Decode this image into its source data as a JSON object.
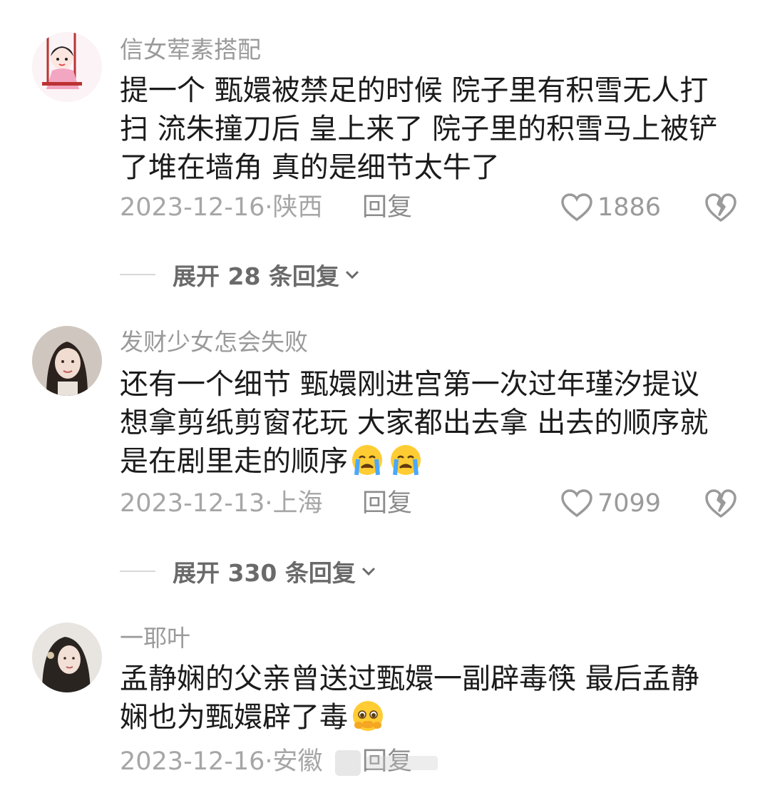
{
  "comments": [
    {
      "username": "信女荤素搭配",
      "lines": [
        "提一个 甄嬛被禁足的时候 院子里有积雪无人打",
        "扫 流朱撞刀后 皇上来了 院子里的积雪马上被铲",
        "了堆在墙角 真的是细节太牛了"
      ],
      "date": "2023-12-16",
      "location": "陕西",
      "date_sep": "·",
      "reply_label": "回复",
      "likes": "1886",
      "expand_label": "展开 28 条回复",
      "avatar_icon": "cartoon-girl-swing-avatar"
    },
    {
      "username": "发财少女怎会失败",
      "lines": [
        "还有一个细节 甄嬛刚进宫第一次过年瑾汐提议",
        "想拿剪纸剪窗花玩 大家都出去拿  出去的顺序就",
        "是在剧里走的顺序"
      ],
      "emoji": "crying-face-emoji",
      "date": "2023-12-13",
      "location": "上海",
      "date_sep": "·",
      "reply_label": "回复",
      "likes": "7099",
      "expand_label": "展开 330 条回复",
      "avatar_icon": "woman-photo-avatar"
    },
    {
      "username": "一耶叶",
      "lines": [
        "孟静娴的父亲曾送过甄嬛一副辟毒筷 最后孟静",
        "娴也为甄嬛辟了毒"
      ],
      "emoji": "pleading-face-emoji",
      "date": "2023-12-16",
      "location": "安徽",
      "date_sep": "·",
      "reply_label": "回复",
      "avatar_icon": "woman-photo-avatar-2"
    }
  ],
  "colors": {
    "username": "#9a9a9a",
    "body": "#1b1b1b",
    "meta": "#a6a6a6",
    "expand": "#6a6a6a"
  }
}
